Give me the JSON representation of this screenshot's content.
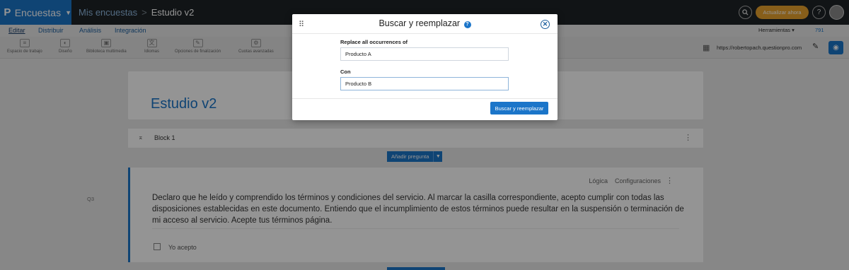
{
  "topbar": {
    "brand_logo": "P",
    "brand_label": "Encuestas",
    "breadcrumb_parent": "Mis encuestas",
    "breadcrumb_sep": ">",
    "breadcrumb_current": "Estudio v2",
    "upgrade_label": "Actualizar ahora",
    "help_glyph": "?",
    "search_glyph": "🔍"
  },
  "menu": {
    "items": [
      "Editar",
      "Distribuir",
      "Análisis",
      "Integración"
    ],
    "tools_label": "Herramientas ▾",
    "user_count": "791"
  },
  "toolbar": {
    "items": [
      "Espacio de trabajo",
      "Diseño",
      "Biblioteca multimedia",
      "Idiomas",
      "Opciones de finalización",
      "Cuotas avanzadas"
    ],
    "url": "https://robertopach.questionpro.com"
  },
  "survey": {
    "title": "Estudio v2",
    "block_name": "Block 1",
    "add_question_label": "Añadir pregunta",
    "question_number": "Q3",
    "logic_link": "Lógica",
    "settings_link": "Configuraciones",
    "question_text": "Declaro que he leído y comprendido los términos y condiciones del servicio. Al marcar la casilla correspondiente, acepto cumplir con todas las disposiciones establecidas en este documento. Entiendo que el incumplimiento de estos términos puede resultar en la suspensión o terminación de mi acceso al servicio. Acepte tus términos página.",
    "option_label": "Yo acepto"
  },
  "modal": {
    "title": "Buscar y reemplazar",
    "help_glyph": "?",
    "close_glyph": "✕",
    "find_label": "Replace all occurrences of",
    "find_value": "Producto A",
    "replace_label": "Con",
    "replace_value": "Producto B",
    "submit_label": "Buscar y reemplazar"
  }
}
